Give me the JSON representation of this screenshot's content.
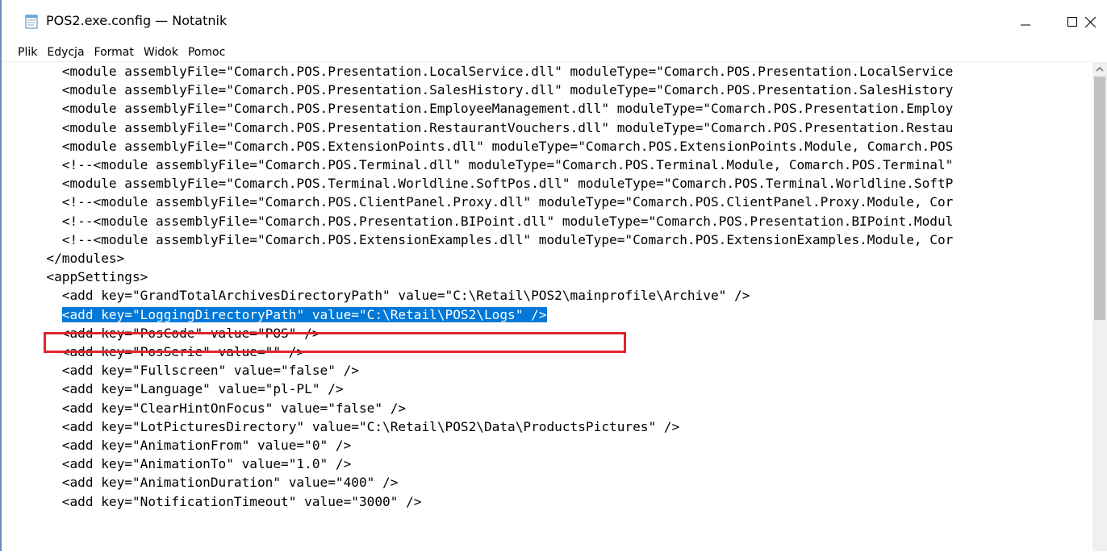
{
  "window": {
    "title": "POS2.exe.config — Notatnik",
    "icons": {
      "app": "notepad-icon",
      "minimize": "minimize-icon",
      "maximize": "maximize-icon",
      "close": "close-icon"
    }
  },
  "menu": {
    "items": [
      "Plik",
      "Edycja",
      "Format",
      "Widok",
      "Pomoc"
    ]
  },
  "editor": {
    "lines": [
      "    <module assemblyFile=\"Comarch.POS.Presentation.LocalService.dll\" moduleType=\"Comarch.POS.Presentation.LocalService",
      "    <module assemblyFile=\"Comarch.POS.Presentation.SalesHistory.dll\" moduleType=\"Comarch.POS.Presentation.SalesHistory",
      "    <module assemblyFile=\"Comarch.POS.Presentation.EmployeeManagement.dll\" moduleType=\"Comarch.POS.Presentation.Employ",
      "    <module assemblyFile=\"Comarch.POS.Presentation.RestaurantVouchers.dll\" moduleType=\"Comarch.POS.Presentation.Restau",
      "    <module assemblyFile=\"Comarch.POS.ExtensionPoints.dll\" moduleType=\"Comarch.POS.ExtensionPoints.Module, Comarch.POS",
      "    <!--<module assemblyFile=\"Comarch.POS.Terminal.dll\" moduleType=\"Comarch.POS.Terminal.Module, Comarch.POS.Terminal\"",
      "    <module assemblyFile=\"Comarch.POS.Terminal.Worldline.SoftPos.dll\" moduleType=\"Comarch.POS.Terminal.Worldline.SoftP",
      "    <!--<module assemblyFile=\"Comarch.POS.ClientPanel.Proxy.dll\" moduleType=\"Comarch.POS.ClientPanel.Proxy.Module, Cor",
      "    <!--<module assemblyFile=\"Comarch.POS.Presentation.BIPoint.dll\" moduleType=\"Comarch.POS.Presentation.BIPoint.Modul",
      "    <!--<module assemblyFile=\"Comarch.POS.ExtensionExamples.dll\" moduleType=\"Comarch.POS.ExtensionExamples.Module, Cor",
      "  </modules>",
      "  <appSettings>",
      "    <add key=\"GrandTotalArchivesDirectoryPath\" value=\"C:\\Retail\\POS2\\mainprofile\\Archive\" />",
      "<add key=\"LoggingDirectoryPath\" value=\"C:\\Retail\\POS2\\Logs\" />",
      "    <add key=\"PosCode\" value=\"POS\" />",
      "    <add key=\"PosSerie\" value=\"\" />",
      "    <add key=\"Fullscreen\" value=\"false\" />",
      "    <add key=\"Language\" value=\"pl-PL\" />",
      "    <add key=\"ClearHintOnFocus\" value=\"false\" />",
      "    <add key=\"LotPicturesDirectory\" value=\"C:\\Retail\\POS2\\Data\\ProductsPictures\" />",
      "    <add key=\"AnimationFrom\" value=\"0\" />",
      "    <add key=\"AnimationTo\" value=\"1.0\" />",
      "    <add key=\"AnimationDuration\" value=\"400\" />",
      "    <add key=\"NotificationTimeout\" value=\"3000\" />"
    ],
    "selected_line_index": 13,
    "selected_indent": "    ",
    "selection_color": "#0078d7",
    "highlight_box_color": "#e0242b"
  },
  "scrollbar": {
    "up_icon": "scroll-up-arrow-icon"
  }
}
